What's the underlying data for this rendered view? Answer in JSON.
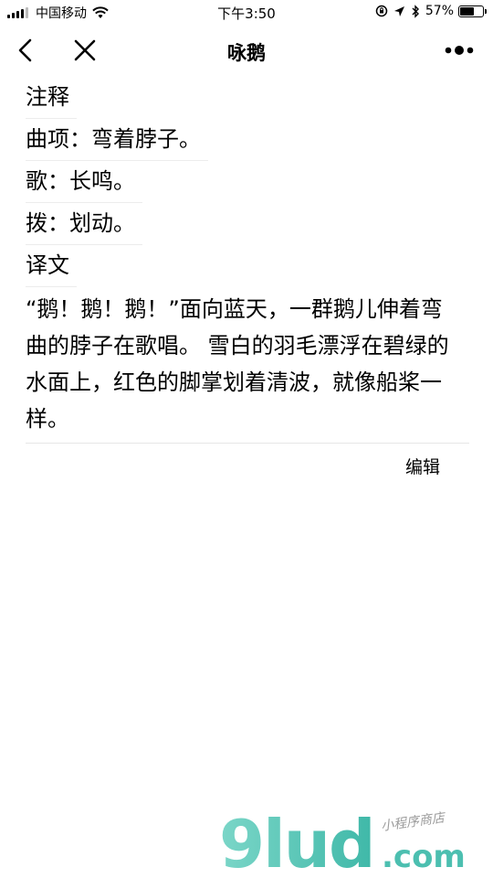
{
  "status_bar": {
    "carrier": "中国移动",
    "time": "下午3:50",
    "battery_text": "57%",
    "battery_level": 0.57
  },
  "nav": {
    "title": "咏鹅"
  },
  "content": {
    "lines": [
      "注释",
      "曲项：弯着脖子。",
      "歌：长鸣。",
      "拨：划动。",
      "译文"
    ],
    "translation": "“鹅！鹅！鹅！”面向蓝天，一群鹅儿伸着弯曲的脖子在歌唱。 雪白的羽毛漂浮在碧绿的水面上，红色的脚掌划着清波，就像船桨一样。",
    "edit_label": "编辑"
  },
  "watermark": {
    "brand": "9lud",
    "domain": ".com",
    "tagline": "小程序商店"
  }
}
